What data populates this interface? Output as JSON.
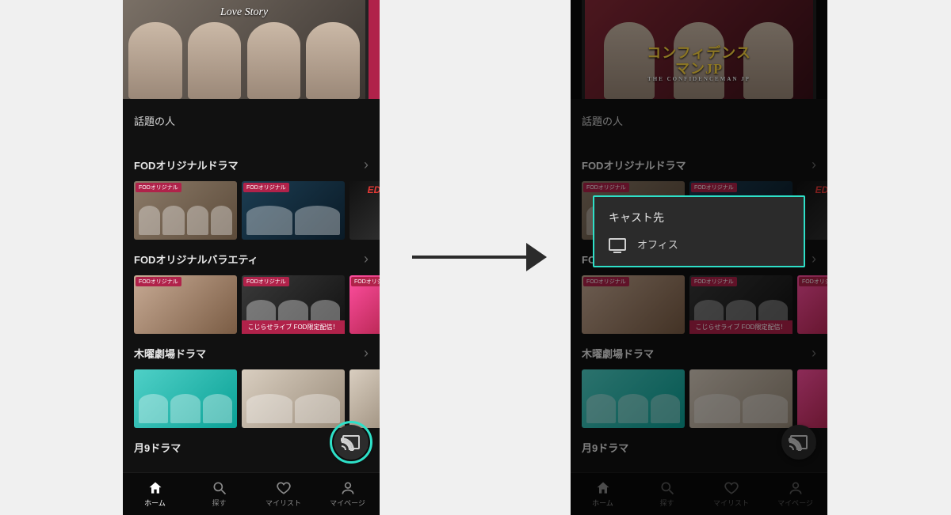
{
  "sections": {
    "s1": "話題の人",
    "s2": "FODオリジナルドラマ",
    "s3": "FODオリジナルバラエティ",
    "s4": "木曜劇場ドラマ",
    "s5": "月9ドラマ"
  },
  "hero": {
    "left_logo": "Love Story",
    "right_title": "コンフィデンスマンJP",
    "right_sub": "THE CONFIDENCEMAN JP"
  },
  "thumbs": {
    "fod_badge": "FODオリジナル",
    "eden": "EDEN",
    "variety_caption": "こじらせライブ FOD限定配信！"
  },
  "cast": {
    "dialog_title": "キャスト先",
    "device": "オフィス"
  },
  "tabs": {
    "home": "ホーム",
    "search": "探す",
    "mylist": "マイリスト",
    "mypage": "マイページ"
  }
}
